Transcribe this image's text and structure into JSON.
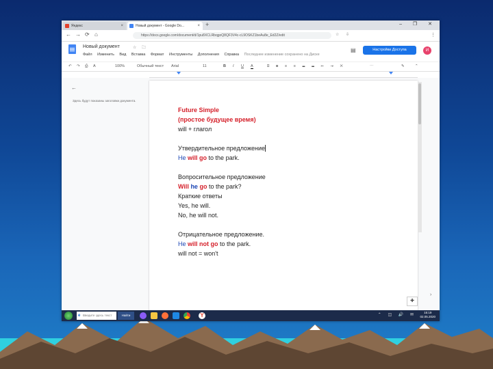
{
  "browser": {
    "tabs": [
      {
        "label": "Яндекс",
        "close": "×",
        "favicon_color": "#e23f2a"
      },
      {
        "label": "Новый документ - Google Do...",
        "close": "×",
        "favicon_color": "#4285f4"
      }
    ],
    "new_tab": "+",
    "window_controls": "– ❐ ✕",
    "nav": {
      "back": "←",
      "forward": "→",
      "reload": "⟳",
      "home": "⌂"
    },
    "url": "https://docs.google.com/document/d/1pu8XCLRbqgoQ8QF3V4c-cL9OSKZ1beAu8e_Ed2Z/edit",
    "menu": "⋮"
  },
  "docs": {
    "title": "Новый документ",
    "title_icons": "☆ 🗀",
    "menu": [
      "Файл",
      "Изменить",
      "Вид",
      "Вставка",
      "Формат",
      "Инструменты",
      "Дополнения",
      "Справка"
    ],
    "last_edit": "Последнее изменение сохранено на Диске",
    "settings_button": "Настройки Доступа",
    "avatar_letter": "И",
    "toolbar": {
      "undo": "↶",
      "redo": "↷",
      "print": "⎙",
      "spell": "A",
      "zoom": "100%",
      "style": "Обычный текст",
      "font": "Arial",
      "font_size": "11",
      "bold": "B",
      "italic": "I",
      "underline": "U",
      "color": "A",
      "more": "⋯",
      "pencil": "✎",
      "collapse": "⌃"
    },
    "outline_back": "←",
    "outline_text": "Здесь будут показаны заголовки документа."
  },
  "document": {
    "title_en": "Future Simple",
    "title_ru": "(простое будущее время)",
    "formula": "will + глагол",
    "affirmative_heading": "Утвердительное предложение",
    "affirmative_subject": "He",
    "affirmative_verb": "will go",
    "affirmative_rest": "to the park.",
    "question_heading": "Вопросительное предложение",
    "question_will": "Will",
    "question_subject": "he",
    "question_verb": "go",
    "question_rest": "to the park?",
    "short_answers_heading": "Краткие ответы",
    "short_yes": "Yes, he will.",
    "short_no": "No, he will not.",
    "negative_heading": "Отрицательное предложение.",
    "negative_subject": "He",
    "negative_verb": "will not go",
    "negative_rest": "to the park.",
    "contraction": "will not = won't"
  },
  "taskbar": {
    "search_placeholder": "Введите здесь текст для поиска",
    "find": "Найти",
    "tray": "⌃ ◫ 🔊 ✉",
    "time": "15:19",
    "date": "02.05.2020"
  },
  "colors": {
    "accent_red": "#d5202a",
    "accent_blue": "#1b46b4",
    "docs_blue": "#1a73e8"
  }
}
